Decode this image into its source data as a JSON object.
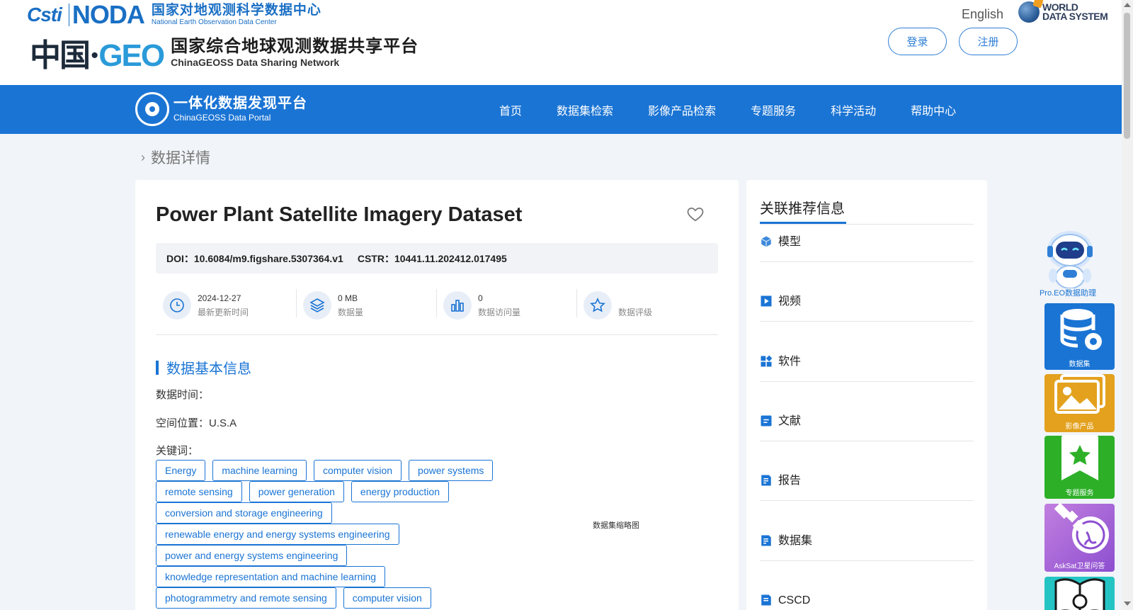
{
  "header": {
    "logo_cstr": "Csti",
    "logo_noda": "NODA",
    "noda_cn": "国家对地观测科学数据中心",
    "noda_en": "National Earth Observation Data Center",
    "geo_mark_cn": "中国",
    "geo_mark_en": "GEO",
    "geoss_cn": "国家综合地球观测数据共享平台",
    "geoss_en": "ChinaGEOSS Data Sharing Network",
    "language": "English",
    "wds_line1": "WORLD",
    "wds_line2": "DATA SYSTEM",
    "login": "登录",
    "register": "注册"
  },
  "nav": {
    "portal_cn": "一体化数据发现平台",
    "portal_en": "ChinaGEOSS Data Portal",
    "items": [
      "首页",
      "数据集检索",
      "影像产品检索",
      "专题服务",
      "科学活动",
      "帮助中心"
    ]
  },
  "breadcrumb": "数据详情",
  "dataset": {
    "title": "Power Plant Satellite Imagery Dataset",
    "doi_label": "DOI：",
    "doi": "10.6084/m9.figshare.5307364.v1",
    "cstr_label": "CSTR：",
    "cstr": "10441.11.202412.017495",
    "stats": [
      {
        "value": "2024-12-27",
        "label": "最新更新时间",
        "icon": "clock-icon"
      },
      {
        "value": "0 MB",
        "label": "数据量",
        "icon": "layers-icon"
      },
      {
        "value": "0",
        "label": "数据访问量",
        "icon": "bar-chart-icon"
      },
      {
        "value": "",
        "label": "数据评级",
        "icon": "star-icon"
      }
    ],
    "section_title": "数据基本信息",
    "time_label": "数据时间：",
    "location_label": "空间位置：U.S.A",
    "keywords_label": "关键词：",
    "keyword_rows": [
      [
        "Energy",
        "machine learning",
        "computer vision",
        "power systems"
      ],
      [
        "remote sensing",
        "power generation",
        "energy production"
      ],
      [
        "conversion and storage engineering"
      ],
      [
        "renewable energy and energy systems engineering"
      ],
      [
        "power and energy systems engineering"
      ],
      [
        "knowledge representation and machine learning"
      ],
      [
        "photogrammetry and remote sensing",
        "computer vision"
      ]
    ],
    "thumbnail_caption": "数据集缩略图"
  },
  "sidebar": {
    "title": "关联推荐信息",
    "items": [
      {
        "label": "模型",
        "icon": "cube-icon"
      },
      {
        "label": "视频",
        "icon": "video-icon"
      },
      {
        "label": "软件",
        "icon": "apps-icon"
      },
      {
        "label": "文献",
        "icon": "document-icon"
      },
      {
        "label": "报告",
        "icon": "report-icon"
      },
      {
        "label": "数据集",
        "icon": "dataset-icon"
      },
      {
        "label": "CSCD",
        "icon": "cscd-icon"
      }
    ]
  },
  "dock": {
    "assistant": "Pro.EO数据助理",
    "dataset": "数据集",
    "image_products": "影像产品",
    "topic_service": "专题服务",
    "asksat": "AskSat卫星问答"
  },
  "colors": {
    "brand_blue": "#1a74d4",
    "dock_data": "#1a74d4",
    "dock_image": "#e3a11e",
    "dock_topic": "#2db028",
    "dock_asksat": "#a565d8",
    "dock_book": "#24c4c4"
  }
}
